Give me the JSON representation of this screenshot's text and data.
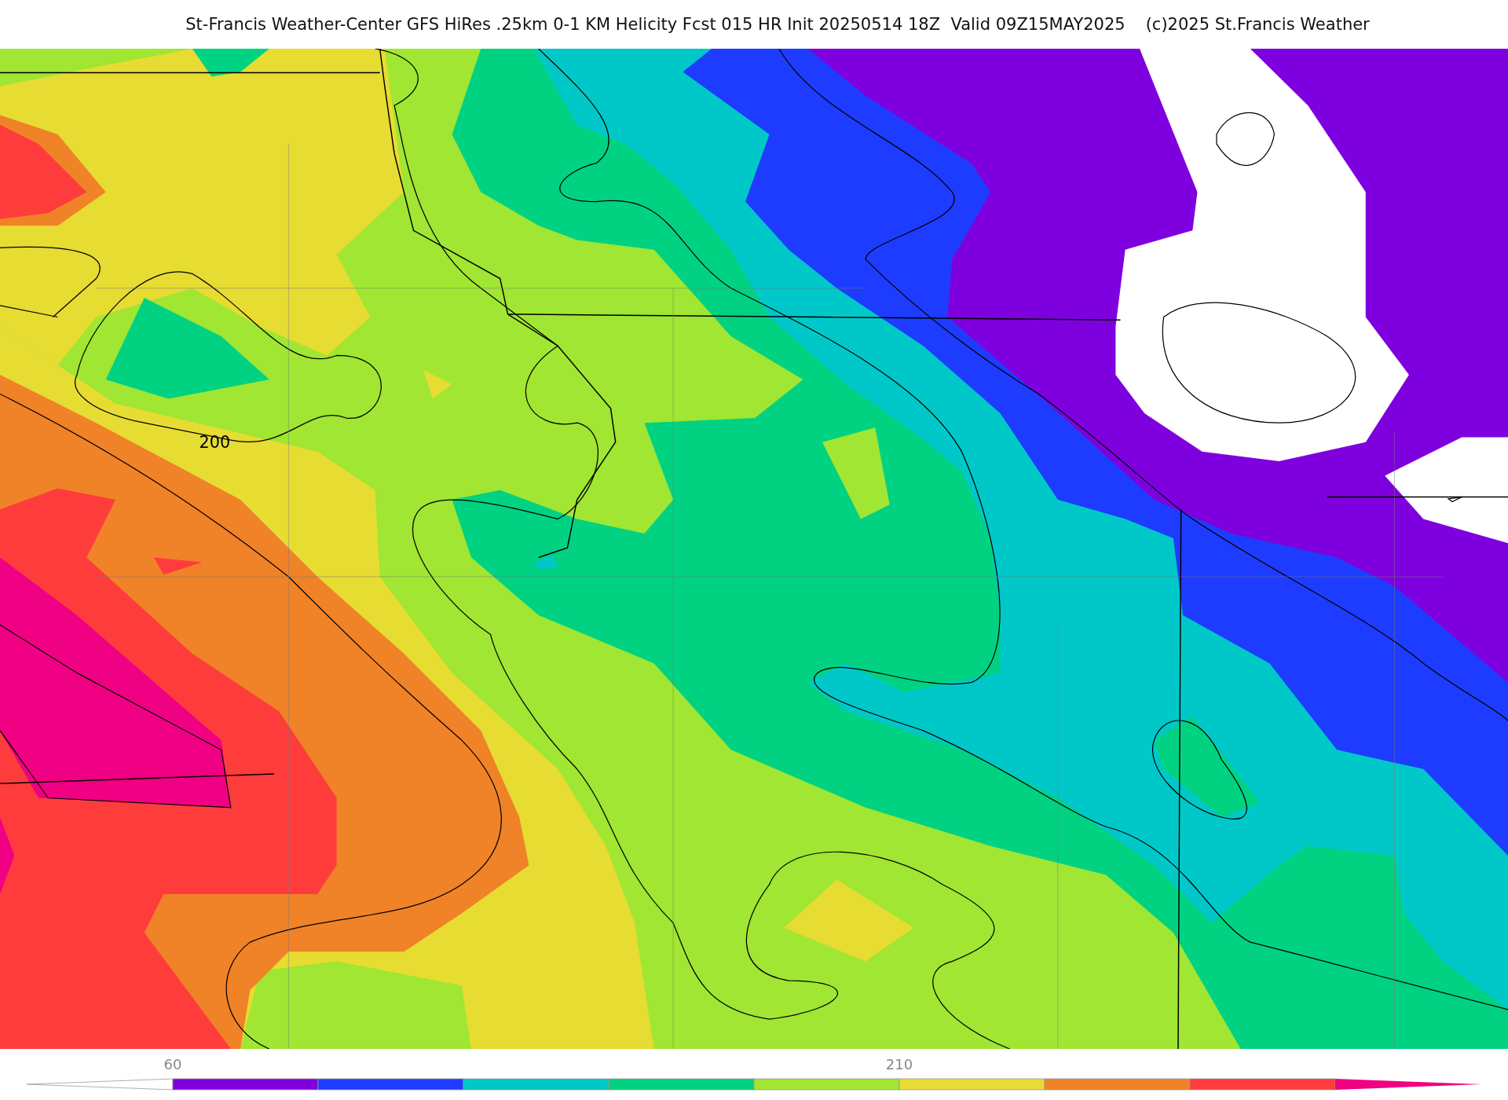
{
  "header": {
    "title": "St-Francis Weather-Center GFS HiRes .25km 0-1 KM Helicity Fcst 015 HR Init 20250514 18Z  Valid 09Z15MAY2025",
    "credit": "(c)2025 St.Francis Weather"
  },
  "map": {
    "contour_label": "200"
  },
  "colorbar": {
    "ticks": [
      "60",
      "210"
    ],
    "segments": [
      {
        "kind": "left-arrow",
        "color": "#ffffff"
      },
      {
        "kind": "box",
        "color": "#7f00df"
      },
      {
        "kind": "box",
        "color": "#1e3cff"
      },
      {
        "kind": "box",
        "color": "#00c8c8"
      },
      {
        "kind": "box",
        "color": "#00d282"
      },
      {
        "kind": "box",
        "color": "#a0e632"
      },
      {
        "kind": "box",
        "color": "#e6dc32"
      },
      {
        "kind": "box",
        "color": "#f08228"
      },
      {
        "kind": "box",
        "color": "#ff3c3c"
      },
      {
        "kind": "right-arrow",
        "color": "#f00082"
      }
    ]
  }
}
